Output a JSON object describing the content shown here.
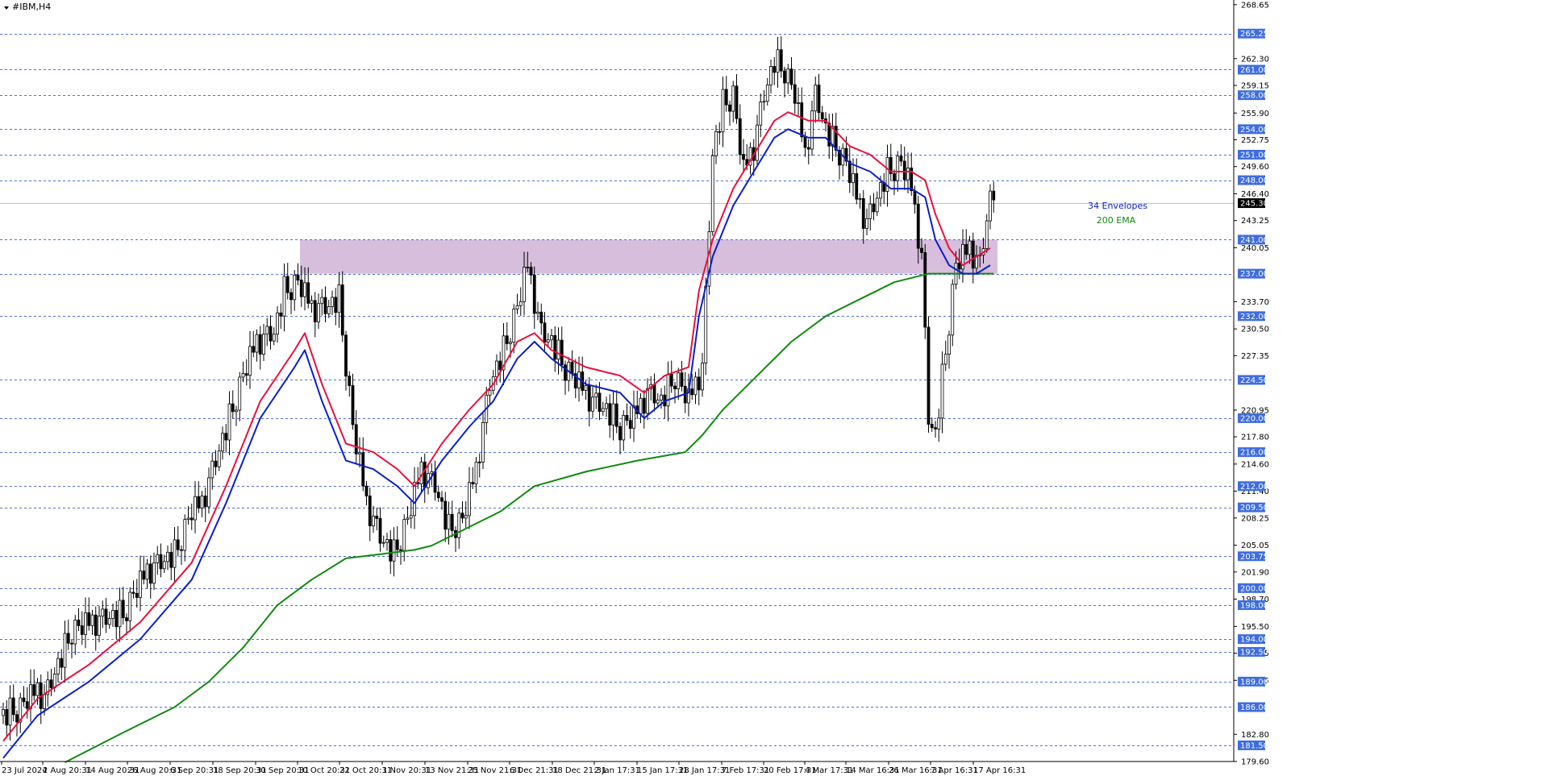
{
  "window": {
    "title": "#IBM,H4",
    "menu_icon": "triangle-down-icon"
  },
  "colors": {
    "level_line": "#4a6fd6",
    "level_tag_bg": "#3f6de0",
    "price_tag_bg": "#000000",
    "zone_fill": "#d6bedc",
    "envelope_upper": "#e8103c",
    "envelope_lower": "#0a1fc8",
    "ema200": "#108a10",
    "candle": "#000000"
  },
  "chart_data": {
    "type": "candlestick",
    "symbol": "#IBM",
    "timeframe": "H4",
    "ylim": [
      179.6,
      269.2
    ],
    "grid": false,
    "y_tick_labels": [
      "268.65",
      "262.30",
      "259.15",
      "255.90",
      "252.75",
      "249.60",
      "246.40",
      "243.25",
      "240.05",
      "233.70",
      "230.50",
      "227.35",
      "220.95",
      "217.80",
      "214.60",
      "211.40",
      "208.25",
      "205.05",
      "201.90",
      "198.70",
      "195.50",
      "192.35",
      "189.15",
      "182.80",
      "179.60"
    ],
    "x_tick_labels": [
      "23 Jul 2024",
      "2 Aug 20:31",
      "14 Aug 20:31",
      "26 Aug 20:31",
      "6 Sep 20:31",
      "18 Sep 20:31",
      "30 Sep 20:31",
      "10 Oct 20:31",
      "22 Oct 20:31",
      "1 Nov 20:31",
      "13 Nov 21:31",
      "25 Nov 21:31",
      "6 Dec 21:31",
      "18 Dec 21:31",
      "2 Jan 17:31",
      "15 Jan 17:31",
      "28 Jan 17:31",
      "7 Feb 17:31",
      "20 Feb 17:31",
      "4 Mar 17:31",
      "14 Mar 16:31",
      "26 Mar 16:31",
      "7 Apr 16:31",
      "17 Apr 16:31"
    ],
    "horizontal_levels": [
      "265.25",
      "261.00",
      "258.00",
      "254.00",
      "251.00",
      "248.00",
      "241.00",
      "237.00",
      "232.00",
      "224.50",
      "220.00",
      "216.00",
      "212.00",
      "209.50",
      "203.75",
      "200.00",
      "198.00",
      "194.00",
      "192.50",
      "189.00",
      "186.00",
      "181.50"
    ],
    "current_price": "245.30",
    "zone": {
      "from_date": "10 Oct 2024",
      "to_date": "17 Apr 2025",
      "low": 237.0,
      "high": 241.0
    },
    "indicators": [
      {
        "name": "34 Envelopes",
        "color": "#0a1fc8"
      },
      {
        "name": "200 EMA",
        "color": "#108a10"
      }
    ],
    "price_path": [
      [
        0,
        185
      ],
      [
        5,
        186
      ],
      [
        10,
        188
      ],
      [
        12,
        187
      ],
      [
        20,
        195
      ],
      [
        26,
        196
      ],
      [
        35,
        197
      ],
      [
        42,
        202
      ],
      [
        50,
        204
      ],
      [
        55,
        209
      ],
      [
        58,
        210
      ],
      [
        62,
        215
      ],
      [
        66,
        220
      ],
      [
        70,
        225
      ],
      [
        74,
        229
      ],
      [
        79,
        230
      ],
      [
        82,
        235
      ],
      [
        86,
        236
      ],
      [
        90,
        233
      ],
      [
        94,
        233
      ],
      [
        98,
        234
      ],
      [
        102,
        219
      ],
      [
        106,
        210
      ],
      [
        110,
        206
      ],
      [
        114,
        204
      ],
      [
        118,
        208
      ],
      [
        122,
        214
      ],
      [
        126,
        212
      ],
      [
        130,
        207
      ],
      [
        134,
        208
      ],
      [
        138,
        214
      ],
      [
        142,
        224
      ],
      [
        146,
        228
      ],
      [
        150,
        233
      ],
      [
        153,
        238
      ],
      [
        157,
        230
      ],
      [
        160,
        229
      ],
      [
        164,
        226
      ],
      [
        168,
        224
      ],
      [
        172,
        222
      ],
      [
        176,
        221
      ],
      [
        180,
        219
      ],
      [
        184,
        220
      ],
      [
        188,
        223
      ],
      [
        192,
        222
      ],
      [
        196,
        225
      ],
      [
        200,
        222
      ],
      [
        204,
        226
      ],
      [
        207,
        251
      ],
      [
        210,
        257
      ],
      [
        213,
        258
      ],
      [
        216,
        249
      ],
      [
        219,
        252
      ],
      [
        222,
        258
      ],
      [
        225,
        262
      ],
      [
        228,
        261
      ],
      [
        231,
        258
      ],
      [
        234,
        251
      ],
      [
        237,
        258
      ],
      [
        240,
        254
      ],
      [
        243,
        252
      ],
      [
        246,
        250
      ],
      [
        249,
        246
      ],
      [
        252,
        243
      ],
      [
        255,
        246
      ],
      [
        258,
        249
      ],
      [
        262,
        250
      ],
      [
        265,
        247
      ],
      [
        268,
        239
      ],
      [
        270,
        220
      ],
      [
        272,
        218
      ],
      [
        275,
        228
      ],
      [
        278,
        238
      ],
      [
        282,
        240
      ],
      [
        285,
        238
      ],
      [
        288,
        246
      ],
      [
        289,
        247
      ]
    ],
    "upper_envelope_path": [
      [
        0,
        182
      ],
      [
        10,
        187
      ],
      [
        25,
        191
      ],
      [
        40,
        196
      ],
      [
        55,
        203
      ],
      [
        65,
        212
      ],
      [
        75,
        222
      ],
      [
        85,
        228
      ],
      [
        88,
        230
      ],
      [
        93,
        224
      ],
      [
        100,
        217
      ],
      [
        108,
        216
      ],
      [
        115,
        214
      ],
      [
        120,
        212
      ],
      [
        128,
        217
      ],
      [
        136,
        221
      ],
      [
        143,
        224
      ],
      [
        150,
        229
      ],
      [
        155,
        230
      ],
      [
        160,
        228
      ],
      [
        170,
        226
      ],
      [
        180,
        225
      ],
      [
        187,
        223
      ],
      [
        193,
        225
      ],
      [
        200,
        226
      ],
      [
        203,
        235
      ],
      [
        207,
        241
      ],
      [
        213,
        247
      ],
      [
        219,
        251
      ],
      [
        225,
        255
      ],
      [
        229,
        256
      ],
      [
        235,
        255
      ],
      [
        240,
        255
      ],
      [
        247,
        252
      ],
      [
        253,
        251
      ],
      [
        259,
        249
      ],
      [
        265,
        249
      ],
      [
        269,
        248
      ],
      [
        272,
        244
      ],
      [
        276,
        240
      ],
      [
        280,
        238
      ],
      [
        284,
        239
      ],
      [
        288,
        240
      ]
    ],
    "lower_envelope_path": [
      [
        0,
        180
      ],
      [
        10,
        185
      ],
      [
        25,
        189
      ],
      [
        40,
        194
      ],
      [
        55,
        201
      ],
      [
        65,
        210
      ],
      [
        75,
        220
      ],
      [
        85,
        226
      ],
      [
        88,
        228
      ],
      [
        93,
        222
      ],
      [
        100,
        215
      ],
      [
        108,
        214
      ],
      [
        115,
        212
      ],
      [
        120,
        210
      ],
      [
        128,
        215
      ],
      [
        136,
        219
      ],
      [
        143,
        222
      ],
      [
        150,
        227
      ],
      [
        155,
        229
      ],
      [
        160,
        227
      ],
      [
        170,
        224
      ],
      [
        180,
        223
      ],
      [
        187,
        220
      ],
      [
        193,
        222
      ],
      [
        200,
        223
      ],
      [
        203,
        232
      ],
      [
        207,
        239
      ],
      [
        213,
        245
      ],
      [
        219,
        249
      ],
      [
        225,
        253
      ],
      [
        229,
        254
      ],
      [
        235,
        253
      ],
      [
        240,
        253
      ],
      [
        247,
        250
      ],
      [
        253,
        249
      ],
      [
        259,
        247
      ],
      [
        265,
        247
      ],
      [
        269,
        246
      ],
      [
        272,
        241
      ],
      [
        276,
        238
      ],
      [
        280,
        237
      ],
      [
        284,
        237
      ],
      [
        288,
        238
      ]
    ],
    "ema200_path": [
      [
        18,
        179.5
      ],
      [
        35,
        183
      ],
      [
        50,
        186
      ],
      [
        60,
        189
      ],
      [
        70,
        193
      ],
      [
        80,
        198
      ],
      [
        90,
        201
      ],
      [
        100,
        203.5
      ],
      [
        110,
        204
      ],
      [
        120,
        204.5
      ],
      [
        125,
        205
      ],
      [
        135,
        207
      ],
      [
        145,
        209
      ],
      [
        155,
        212
      ],
      [
        170,
        213.7
      ],
      [
        185,
        215
      ],
      [
        199,
        216
      ],
      [
        204,
        218
      ],
      [
        210,
        221
      ],
      [
        220,
        225
      ],
      [
        230,
        229
      ],
      [
        240,
        232
      ],
      [
        250,
        234
      ],
      [
        260,
        236
      ],
      [
        270,
        237
      ],
      [
        278,
        237
      ],
      [
        285,
        237
      ],
      [
        289,
        237
      ]
    ]
  }
}
